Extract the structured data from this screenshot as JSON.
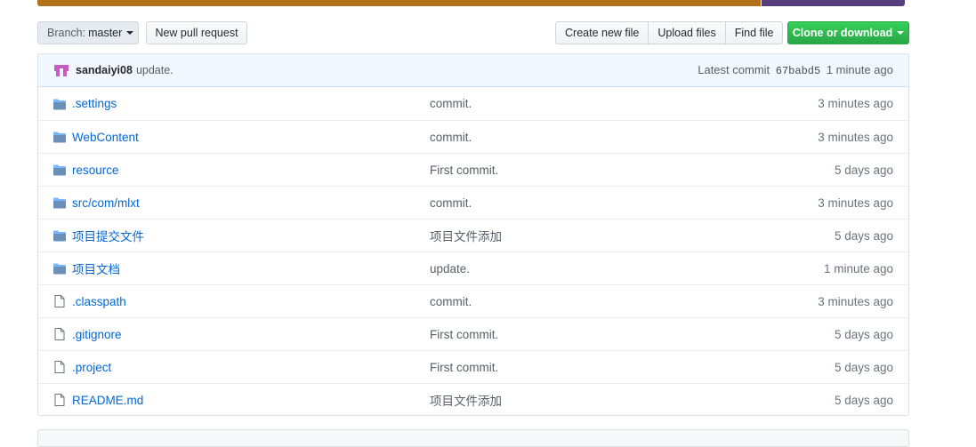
{
  "colors": {
    "lang_primary": "#b07219",
    "lang_secondary": "#563d7c",
    "link": "#0366d6",
    "green": "#28a745",
    "folder": "#79b8ff"
  },
  "toolbar": {
    "branch_prefix": "Branch:",
    "branch_name": "master",
    "new_pull_request": "New pull request",
    "create_new_file": "Create new file",
    "upload_files": "Upload files",
    "find_file": "Find file",
    "clone_or_download": "Clone or download"
  },
  "commit": {
    "author": "sandaiyi08",
    "message": "update.",
    "latest_label": "Latest commit",
    "sha": "67babd5",
    "time": "1 minute ago"
  },
  "files": [
    {
      "type": "folder",
      "name": ".settings",
      "message": "commit.",
      "age": "3 minutes ago"
    },
    {
      "type": "folder",
      "name": "WebContent",
      "message": "commit.",
      "age": "3 minutes ago"
    },
    {
      "type": "folder",
      "name": "resource",
      "message": "First commit.",
      "age": "5 days ago"
    },
    {
      "type": "folder",
      "name": "src/com/mlxt",
      "message": "commit.",
      "age": "3 minutes ago"
    },
    {
      "type": "folder",
      "name": "项目提交文件",
      "message": "项目文件添加",
      "age": "5 days ago"
    },
    {
      "type": "folder",
      "name": "项目文档",
      "message": "update.",
      "age": "1 minute ago"
    },
    {
      "type": "file",
      "name": ".classpath",
      "message": "commit.",
      "age": "3 minutes ago"
    },
    {
      "type": "file",
      "name": ".gitignore",
      "message": "First commit.",
      "age": "5 days ago"
    },
    {
      "type": "file",
      "name": ".project",
      "message": "First commit.",
      "age": "5 days ago"
    },
    {
      "type": "file",
      "name": "README.md",
      "message": "项目文件添加",
      "age": "5 days ago"
    }
  ]
}
